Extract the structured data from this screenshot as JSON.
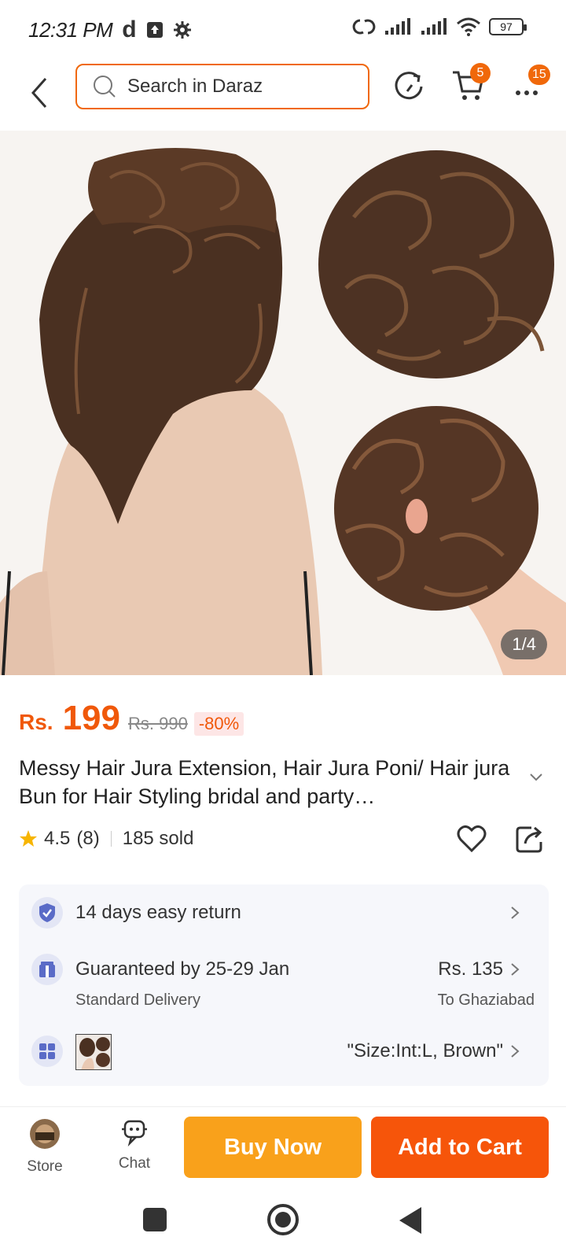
{
  "status_bar": {
    "time": "12:31 PM",
    "app_glyph": "d",
    "battery": "97"
  },
  "header": {
    "search_placeholder": "Search in Daraz",
    "cart_badge": "5",
    "more_badge": "15"
  },
  "gallery": {
    "counter": "1/4"
  },
  "product": {
    "currency": "Rs.",
    "price": "199",
    "old_price": "Rs. 990",
    "discount": "-80%",
    "title": "Messy Hair Jura Extension, Hair Jura Poni/ Hair jura Bun for Hair Styling bridal and party…",
    "rating": "4.5",
    "rating_count": "(8)",
    "sold": "185 sold",
    "rating_value": 4.5
  },
  "info": {
    "return_text": "14 days easy return",
    "delivery_text": "Guaranteed by 25-29 Jan",
    "delivery_sub": "Standard Delivery",
    "delivery_price": "Rs. 135",
    "delivery_to": "To Ghaziabad",
    "variant": "\"Size:Int:L, Brown\""
  },
  "bottom_bar": {
    "store_label": "Store",
    "chat_label": "Chat",
    "buy_now": "Buy Now",
    "add_to_cart": "Add to Cart"
  },
  "colors": {
    "accent": "#f0680a",
    "buy_now": "#f9a11b",
    "add_to_cart": "#f6550a"
  }
}
